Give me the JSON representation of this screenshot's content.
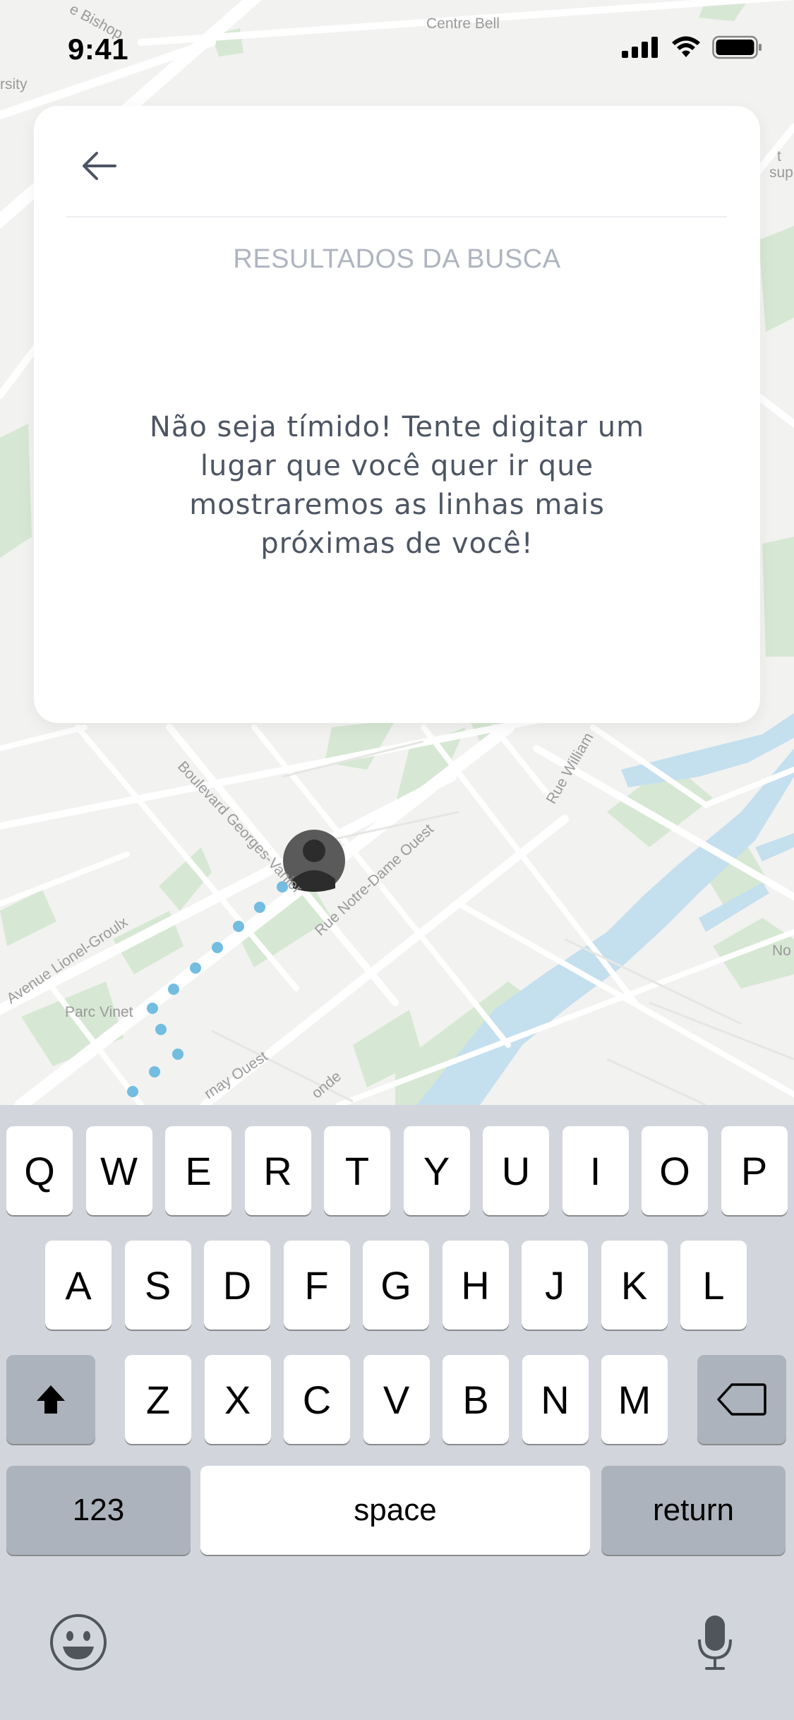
{
  "status_bar": {
    "time": "9:41",
    "icons": [
      "signal-icon",
      "wifi-icon",
      "battery-icon"
    ]
  },
  "map": {
    "labels": {
      "centre_bell": "Centre Bell",
      "bishop": "e Bishop",
      "rsity": "rsity",
      "boulevard": "Boulevard Georges-Vanier",
      "notre_dame": "Rue Notre-Dame Ouest",
      "william": "Rue William",
      "lionel": "Avenue Lionel-Groulx",
      "parc_vinet": "Parc Vinet",
      "rnay": "rnay Ouest",
      "onde": "onde",
      "no": "No",
      "edge_t": "t",
      "edge_sup": "sup"
    },
    "colors": {
      "land": "#f2f2f0",
      "road": "#ffffff",
      "park": "#d6e8d3",
      "water": "#c4dfee",
      "route_dots": "#72bde0"
    }
  },
  "card": {
    "results_title": "RESULTADOS DA BUSCA",
    "empty_message": "Não seja tímido! Tente digitar um lugar que você quer ir que mostraremos as linhas mais próximas de você!"
  },
  "keyboard": {
    "row1": [
      "Q",
      "W",
      "E",
      "R",
      "T",
      "Y",
      "U",
      "I",
      "O",
      "P"
    ],
    "row2": [
      "A",
      "S",
      "D",
      "F",
      "G",
      "H",
      "J",
      "K",
      "L"
    ],
    "row3": [
      "Z",
      "X",
      "C",
      "V",
      "B",
      "N",
      "M"
    ],
    "numbers_key": "123",
    "space_key": "space",
    "return_key": "return",
    "icons": [
      "shift-icon",
      "backspace-icon",
      "emoji-icon",
      "microphone-icon"
    ]
  }
}
